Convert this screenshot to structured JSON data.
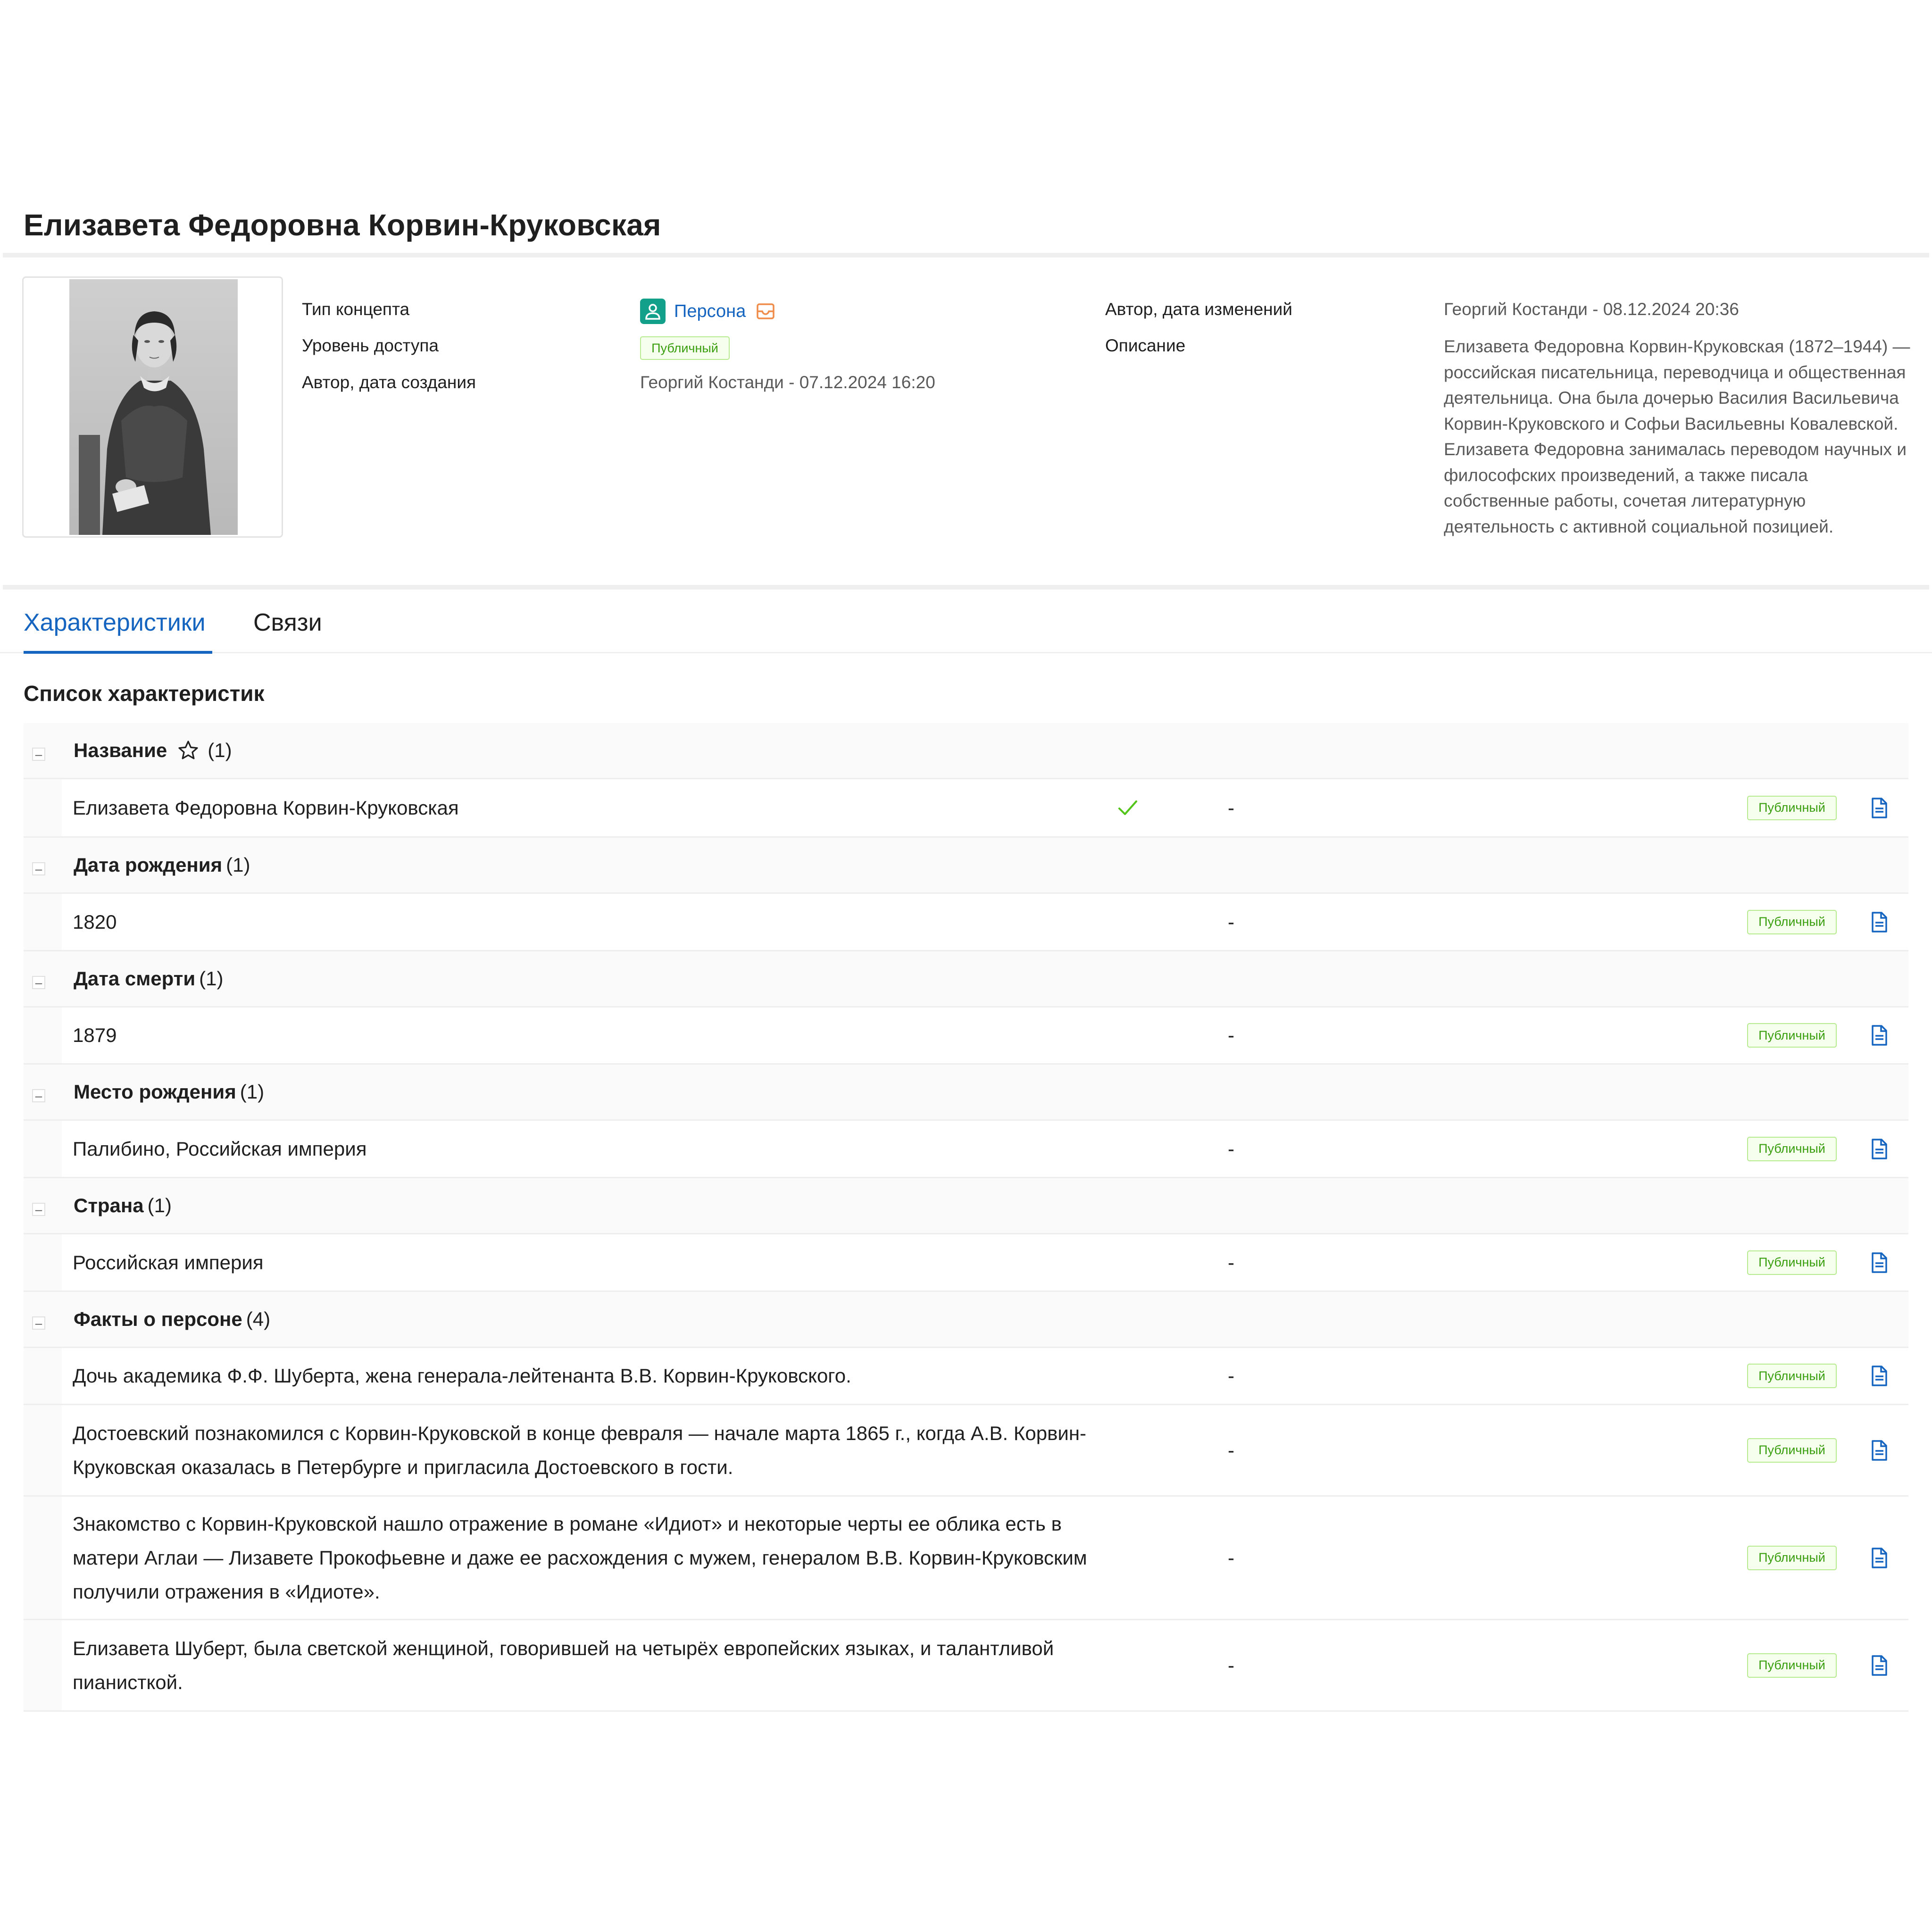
{
  "page": {
    "title": "Елизавета Федоровна Корвин-Круковская"
  },
  "meta": {
    "concept_type_label": "Тип концепта",
    "concept_type_value": "Персона",
    "access_level_label": "Уровень доступа",
    "access_level_value": "Публичный",
    "created_label": "Автор, дата создания",
    "created_value": "Георгий  Костанди - 07.12.2024 16:20",
    "modified_label": "Автор, дата изменений",
    "modified_value": "Георгий  Костанди - 08.12.2024 20:36",
    "description_label": "Описание",
    "description_value": "Елизавета Федоровна Корвин-Круковская (1872–1944) — российская писательница, переводчица и общественная деятельница. Она была дочерью Василия Васильевича Корвин-Круковского и Софьи Васильевны Ковалевской. Елизавета Федоровна занималась переводом научных и философских произведений, а также писала собственные работы, сочетая литературную деятельность с активной социальной позицией.",
    "concept_icon": "person-icon",
    "concept_tray_icon": "inbox-icon",
    "concept_color": "#13a08a",
    "link_color": "#1565c0"
  },
  "tabs": [
    {
      "label": "Характеристики",
      "active": true
    },
    {
      "label": "Связи",
      "active": false
    }
  ],
  "characteristics": {
    "title": "Список характеристик",
    "collapse_symbol": "–",
    "dash": "-",
    "status_color": "#389e0d",
    "groups": [
      {
        "name": "Название",
        "count": "(1)",
        "starred": true,
        "items": [
          {
            "text": "Елизавета Федоровна Корвин-Круковская",
            "checked": true,
            "status": "Публичный"
          }
        ]
      },
      {
        "name": "Дата рождения",
        "count": "(1)",
        "items": [
          {
            "text": "1820",
            "status": "Публичный"
          }
        ]
      },
      {
        "name": "Дата смерти",
        "count": "(1)",
        "items": [
          {
            "text": "1879",
            "status": "Публичный"
          }
        ]
      },
      {
        "name": "Место рождения",
        "count": "(1)",
        "items": [
          {
            "text": "Палибино, Российская империя",
            "status": "Публичный"
          }
        ]
      },
      {
        "name": "Страна",
        "count": "(1)",
        "items": [
          {
            "text": "Российская империя",
            "status": "Публичный"
          }
        ]
      },
      {
        "name": "Факты о персоне",
        "count": "(4)",
        "items": [
          {
            "text": "Дочь академика Ф.Ф. Шуберта, жена генерала-лейтенанта В.В. Корвин-Круковского.",
            "status": "Публичный"
          },
          {
            "text": "Достоевский познакомился с Корвин-Круковской в конце февраля — начале марта 1865 г., когда А.В. Корвин-Круковская оказалась в Петербурге и пригласила Достоевского в гости.",
            "status": "Публичный"
          },
          {
            "text": "Знакомство с Корвин-Круковской нашло отражение в романе «Идиот» и некоторые черты ее облика есть в матери Аглаи — Лизавете Прокофьевне и даже ее расхождения с мужем, генералом В.В. Корвин-Круковским получили отражения в «Идиоте».",
            "status": "Публичный"
          },
          {
            "text": "Елизавета Шуберт, была светской женщиной, говорившей на четырёх европейских языках, и талантливой пианисткой.",
            "status": "Публичный"
          }
        ]
      }
    ]
  }
}
